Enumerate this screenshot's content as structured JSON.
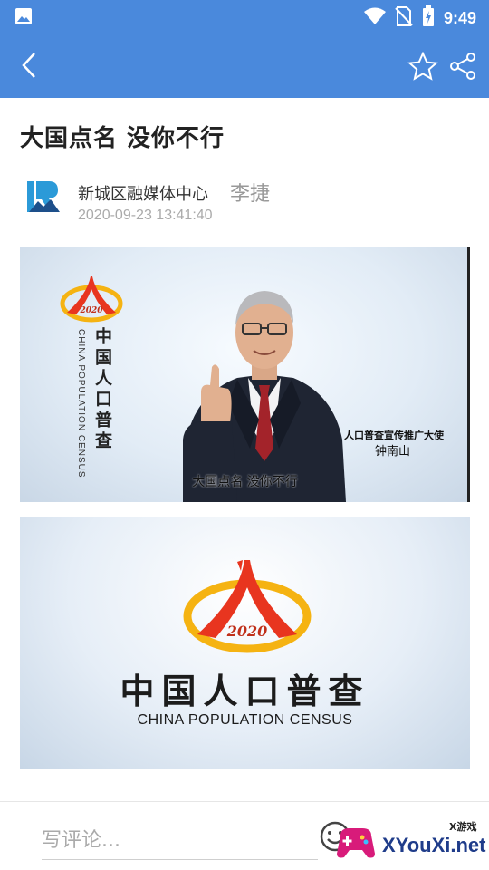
{
  "status_bar": {
    "time": "9:49",
    "icons": [
      "image-icon",
      "wifi-icon",
      "no-sim-icon",
      "battery-charging-icon"
    ]
  },
  "app_bar": {
    "back_icon": "chevron-left-icon",
    "favorite_icon": "star-outline-icon",
    "share_icon": "share-icon"
  },
  "article": {
    "title": "大国点名 没你不行",
    "source": "新城区融媒体中心",
    "author": "李捷",
    "publish_time": "2020-09-23 13:41:40"
  },
  "image1": {
    "logo_year": "2020",
    "vertical_title": "中国人口普查",
    "vertical_en": "CHINA POPULATION CENSUS",
    "caption_role": "人口普查宣传推广大使",
    "caption_name": "钟南山",
    "subtitle": "大国点名  没你不行"
  },
  "image2": {
    "logo_year": "2020",
    "title_cn": "中国人口普查",
    "title_en": "CHINA POPULATION CENSUS"
  },
  "comment_bar": {
    "placeholder": "写评论...",
    "emoji_icon": "emoji-smile-icon"
  },
  "watermark": {
    "top_text": "X游戏",
    "site": "XYouXi.net"
  },
  "colors": {
    "header_blue": "#4a89dc",
    "logo_red": "#e8351f",
    "logo_gold": "#f5b312"
  }
}
